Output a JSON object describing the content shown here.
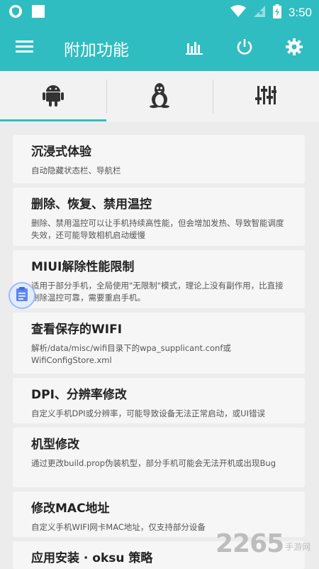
{
  "status_bar": {
    "time": "3:50"
  },
  "toolbar": {
    "title": "附加功能"
  },
  "tabs": [
    {
      "icon": "android-icon"
    },
    {
      "icon": "linux-penguin-icon"
    },
    {
      "icon": "sliders-icon"
    }
  ],
  "items": [
    {
      "title": "沉浸式体验",
      "desc": "自动隐藏状态栏、导航栏"
    },
    {
      "title": "删除、恢复、禁用温控",
      "desc": "删除、禁用温控可以让手机持续高性能，但会增加发热、导致智能调度失效，还可能导致相机启动缓慢"
    },
    {
      "title": "MIUI解除性能限制",
      "desc": "适用于部分手机，全局使用\"无限制\"模式，理论上没有副作用，比直接删除温控可靠，需要重启手机。"
    },
    {
      "title": "查看保存的WIFI",
      "desc": "解析/data/misc/wifi目录下的wpa_supplicant.conf或WifiConfigStore.xml"
    },
    {
      "title": "DPI、分辨率修改",
      "desc": "自定义手机DPI或分辨率，可能导致设备无法正常启动，或UI错误"
    },
    {
      "title": "机型修改",
      "desc": "通过更改build.prop伪装机型，部分手机可能会无法开机或出现Bug"
    },
    {
      "title": "修改MAC地址",
      "desc": "自定义手机WIFI网卡MAC地址，仅支持部分设备"
    },
    {
      "title": "应用安装 · oksu 策略",
      "desc": ""
    }
  ],
  "watermark": {
    "number": "2265",
    "suffix": "手游网"
  }
}
